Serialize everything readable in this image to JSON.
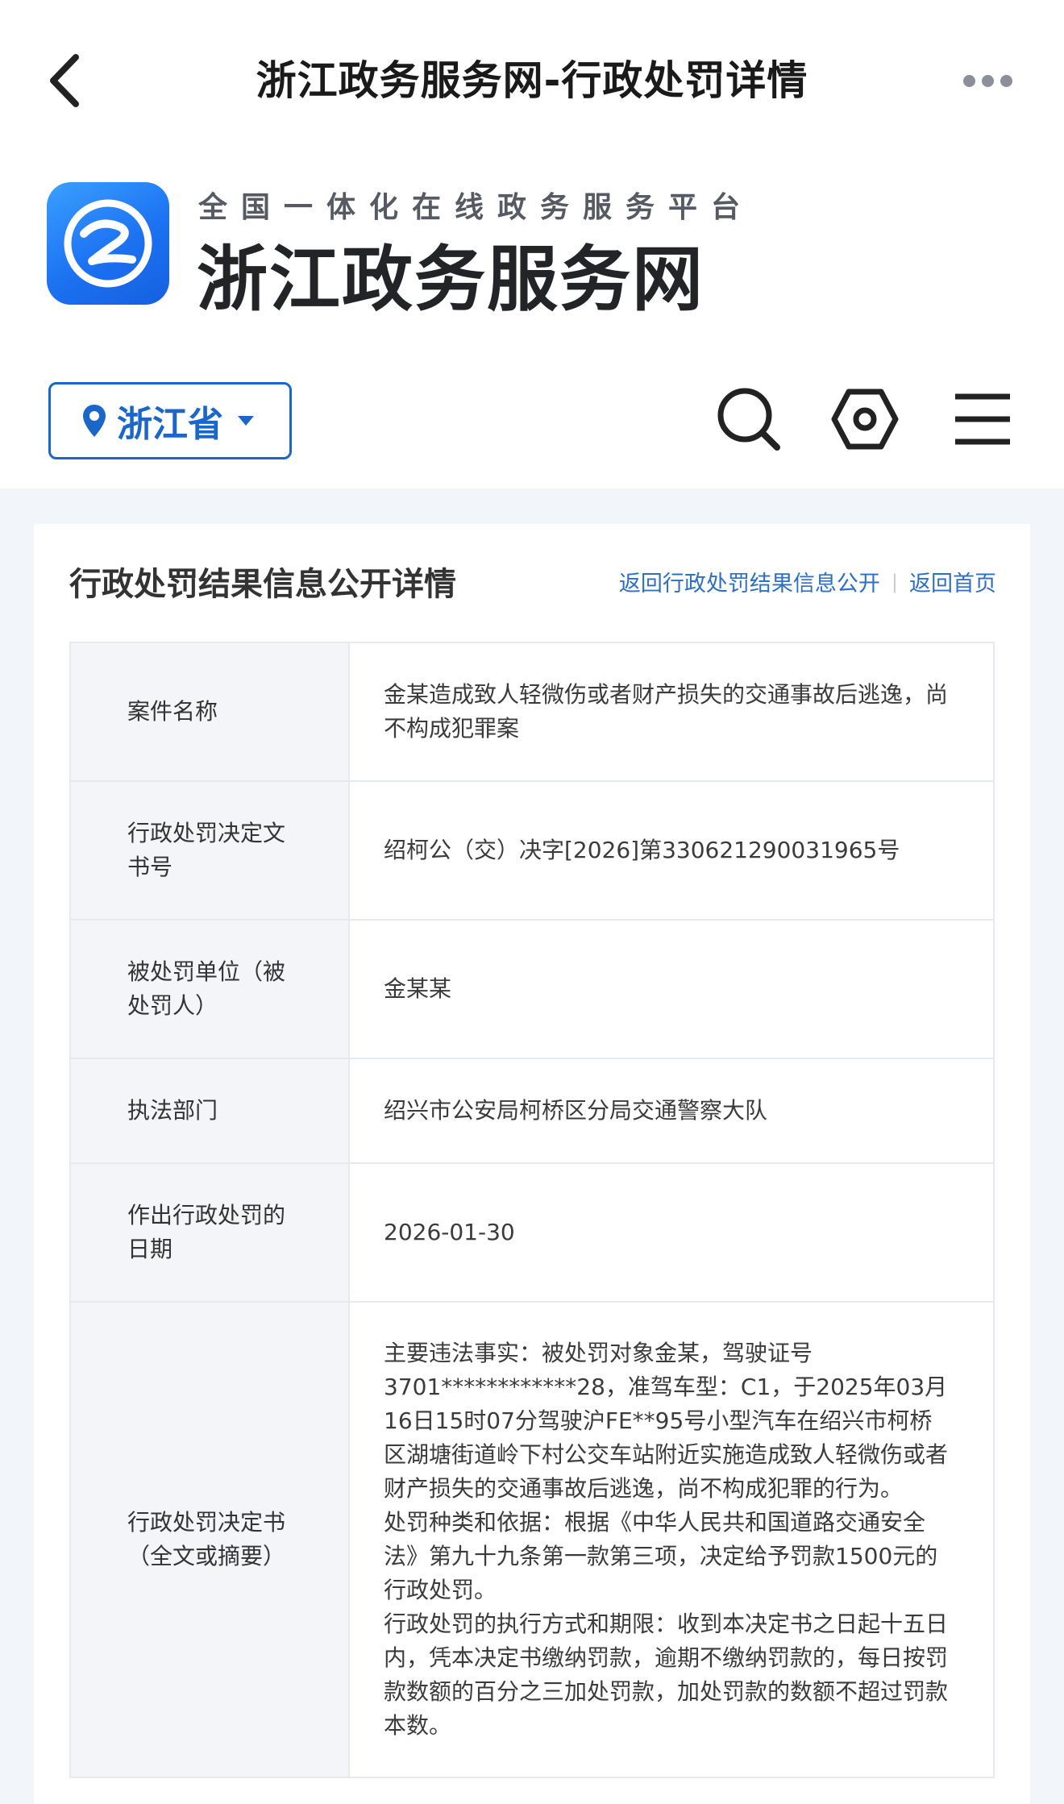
{
  "topbar": {
    "title": "浙江政务服务网-行政处罚详情"
  },
  "brand": {
    "subtitle": "全国一体化在线政务服务平台",
    "name": "浙江政务服务网"
  },
  "region": {
    "label": "浙江省"
  },
  "colors": {
    "accent": "#1a66c9",
    "link": "#2e6fc4",
    "logo": "#1c72f2",
    "page_bg": "#f2f5f9"
  },
  "section": {
    "title": "行政处罚结果信息公开详情",
    "link_back_list": "返回行政处罚结果信息公开",
    "separator": "|",
    "link_home": "返回首页"
  },
  "table": {
    "rows": [
      {
        "key": "案件名称",
        "value": "金某造成致人轻微伤或者财产损失的交通事故后逃逸，尚不构成犯罪案"
      },
      {
        "key": "行政处罚决定文书号",
        "value": "绍柯公（交）决字[2026]第330621290031965号"
      },
      {
        "key": "被处罚单位（被处罚人）",
        "value": "金某某"
      },
      {
        "key": "执法部门",
        "value": "绍兴市公安局柯桥区分局交通警察大队"
      },
      {
        "key": "作出行政处罚的日期",
        "value": "2026-01-30"
      },
      {
        "key": "行政处罚决定书（全文或摘要）",
        "paragraphs": [
          "主要违法事实：被处罚对象金某，驾驶证号3701************28，准驾车型：C1，于2025年03月16日15时07分驾驶沪FE**95号小型汽车在绍兴市柯桥区湖塘街道岭下村公交车站附近实施造成致人轻微伤或者财产损失的交通事故后逃逸，尚不构成犯罪的行为。",
          "处罚种类和依据：根据《中华人民共和国道路交通安全法》第九十九条第一款第三项，决定给予罚款1500元的行政处罚。",
          "行政处罚的执行方式和期限：收到本决定书之日起十五日内，凭本决定书缴纳罚款，逾期不缴纳罚款的，每日按罚款数额的百分之三加处罚款，加处罚款的数额不超过罚款本数。"
        ]
      }
    ]
  }
}
